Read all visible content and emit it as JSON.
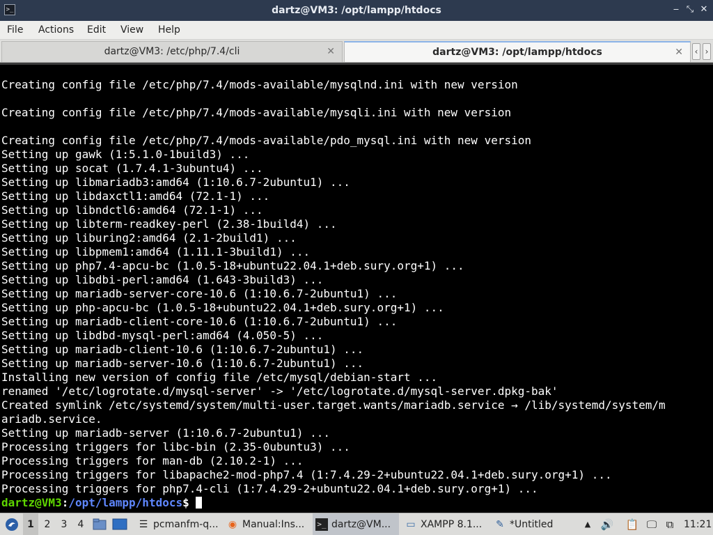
{
  "window": {
    "title": "dartz@VM3: /opt/lampp/htdocs",
    "minimize_glyph": "‒",
    "maximize_glyph": "⤡",
    "close_glyph": "✕",
    "app_icon_glyph": ">_"
  },
  "menubar": {
    "items": [
      "File",
      "Actions",
      "Edit",
      "View",
      "Help"
    ]
  },
  "tabs": [
    {
      "label": "dartz@VM3: /etc/php/7.4/cli",
      "active": false,
      "close_glyph": "✕"
    },
    {
      "label": "dartz@VM3: /opt/lampp/htdocs",
      "active": true,
      "close_glyph": "✕"
    }
  ],
  "tab_scroll": {
    "left": "‹",
    "right": "›"
  },
  "terminal": {
    "lines": [
      "Creating config file /etc/php/7.4/mods-available/mysqlnd.ini with new version",
      "",
      "Creating config file /etc/php/7.4/mods-available/mysqli.ini with new version",
      "",
      "Creating config file /etc/php/7.4/mods-available/pdo_mysql.ini with new version",
      "Setting up gawk (1:5.1.0-1build3) ...",
      "Setting up socat (1.7.4.1-3ubuntu4) ...",
      "Setting up libmariadb3:amd64 (1:10.6.7-2ubuntu1) ...",
      "Setting up libdaxctl1:amd64 (72.1-1) ...",
      "Setting up libndctl6:amd64 (72.1-1) ...",
      "Setting up libterm-readkey-perl (2.38-1build4) ...",
      "Setting up liburing2:amd64 (2.1-2build1) ...",
      "Setting up libpmem1:amd64 (1.11.1-3build1) ...",
      "Setting up php7.4-apcu-bc (1.0.5-18+ubuntu22.04.1+deb.sury.org+1) ...",
      "Setting up libdbi-perl:amd64 (1.643-3build3) ...",
      "Setting up mariadb-server-core-10.6 (1:10.6.7-2ubuntu1) ...",
      "Setting up php-apcu-bc (1.0.5-18+ubuntu22.04.1+deb.sury.org+1) ...",
      "Setting up mariadb-client-core-10.6 (1:10.6.7-2ubuntu1) ...",
      "Setting up libdbd-mysql-perl:amd64 (4.050-5) ...",
      "Setting up mariadb-client-10.6 (1:10.6.7-2ubuntu1) ...",
      "Setting up mariadb-server-10.6 (1:10.6.7-2ubuntu1) ...",
      "Installing new version of config file /etc/mysql/debian-start ...",
      "renamed '/etc/logrotate.d/mysql-server' -> '/etc/logrotate.d/mysql-server.dpkg-bak'",
      "Created symlink /etc/systemd/system/multi-user.target.wants/mariadb.service → /lib/systemd/system/m",
      "ariadb.service.",
      "Setting up mariadb-server (1:10.6.7-2ubuntu1) ...",
      "Processing triggers for libc-bin (2.35-0ubuntu3) ...",
      "Processing triggers for man-db (2.10.2-1) ...",
      "Processing triggers for libapache2-mod-php7.4 (1:7.4.29-2+ubuntu22.04.1+deb.sury.org+1) ...",
      "Processing triggers for php7.4-cli (1:7.4.29-2+ubuntu22.04.1+deb.sury.org+1) ..."
    ],
    "prompt": {
      "user_host": "dartz@VM3",
      "separator": ":",
      "path": "/opt/lampp/htdocs",
      "symbol": "$ "
    }
  },
  "taskbar": {
    "start_icon": "start-menu-icon",
    "workspaces": [
      "1",
      "2",
      "3",
      "4"
    ],
    "active_workspace": "1",
    "quick_launch": [
      "file-manager-icon",
      "show-desktop-icon"
    ],
    "tasks": [
      {
        "label": "pcmanfm-q...",
        "icon": "file-list-icon",
        "glyph": "☰",
        "active": false
      },
      {
        "label": "Manual:Ins...",
        "icon": "firefox-icon",
        "glyph": "◉",
        "active": false
      },
      {
        "label": "dartz@VM...",
        "icon": "terminal-icon",
        "glyph": ">_",
        "active": true
      },
      {
        "label": "XAMPP 8.1...",
        "icon": "window-icon",
        "glyph": "▭",
        "active": false
      },
      {
        "label": "*Untitled",
        "icon": "text-editor-icon",
        "glyph": "✎",
        "active": false
      }
    ],
    "tray": [
      {
        "icon": "up-arrow-icon",
        "glyph": "▲"
      },
      {
        "icon": "volume-icon",
        "glyph": "🔊"
      },
      {
        "icon": "clipboard-icon",
        "glyph": "📋"
      },
      {
        "icon": "display-icon",
        "glyph": "🖵"
      },
      {
        "icon": "network-icon",
        "glyph": "⧉"
      }
    ],
    "clock": "11:21"
  }
}
